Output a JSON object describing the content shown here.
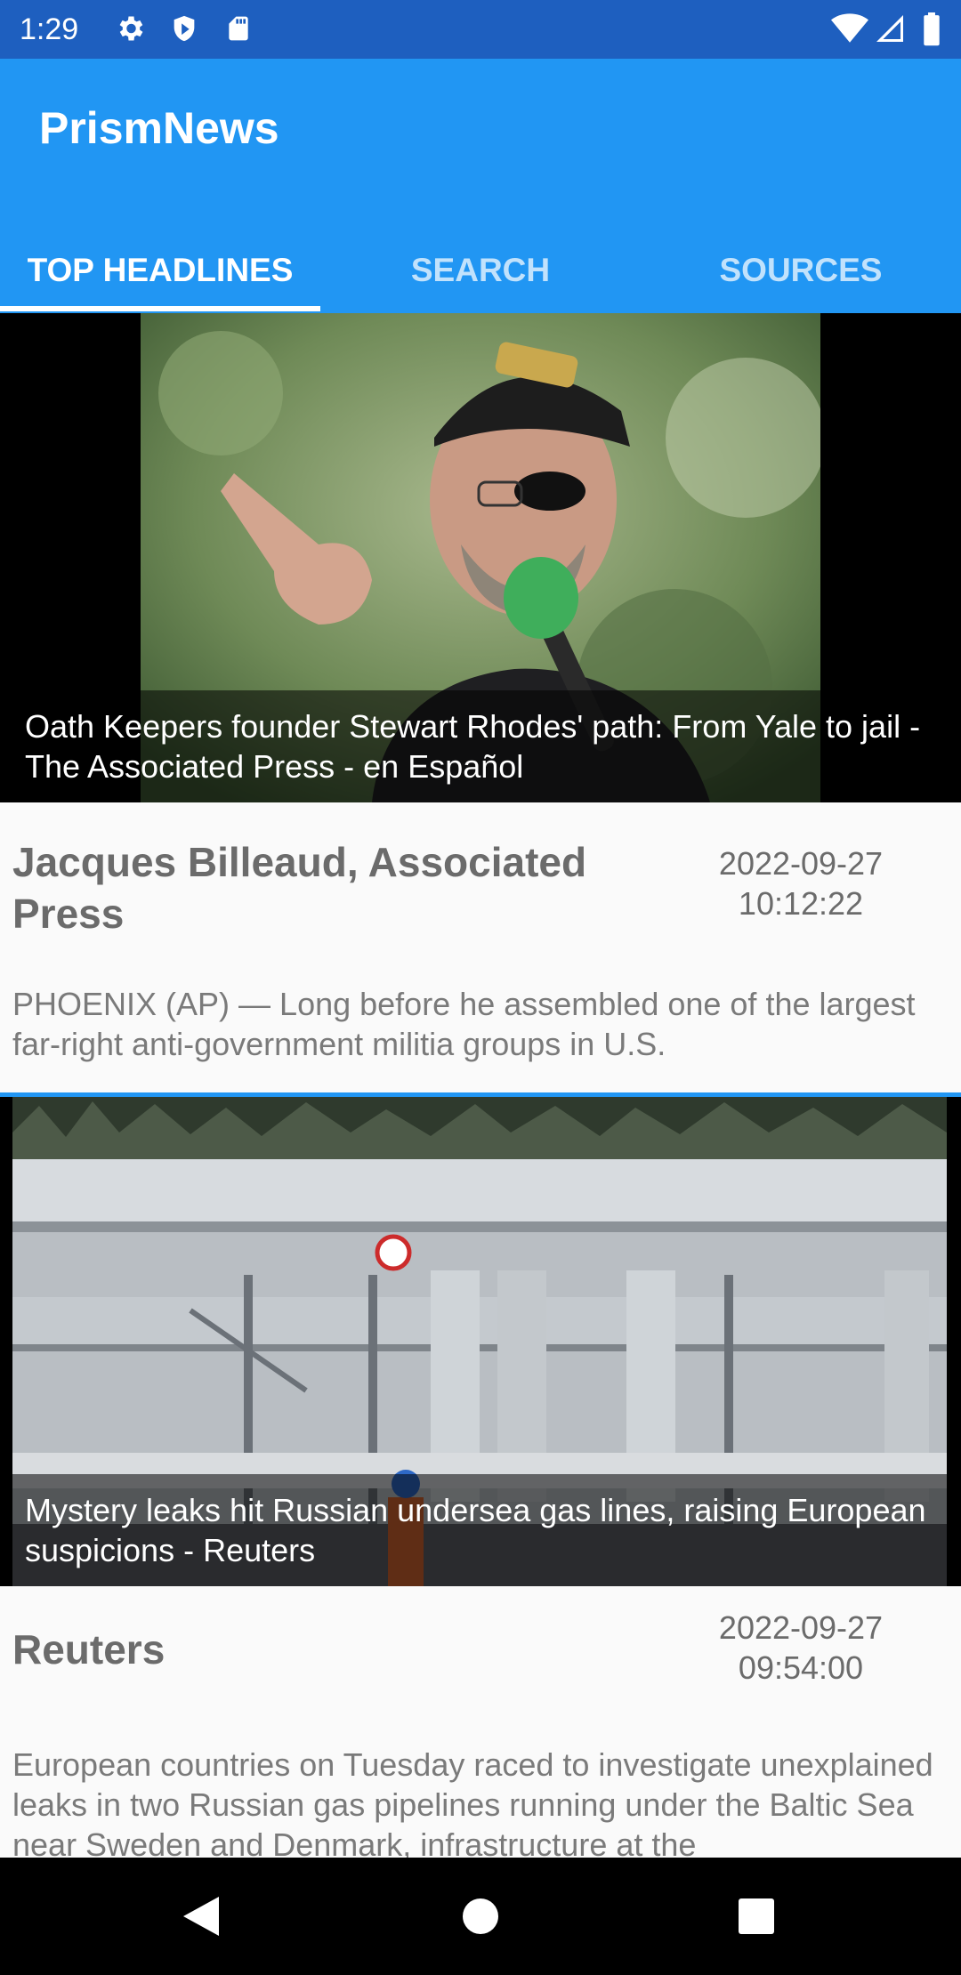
{
  "status_bar": {
    "time": "1:29",
    "icons": [
      "gear-icon",
      "shield-icon",
      "sd-card-icon",
      "wifi-icon",
      "signal-icon",
      "battery-icon"
    ]
  },
  "app": {
    "title": "PrismNews",
    "accent_color": "#2196f3"
  },
  "tabs": [
    {
      "label": "TOP HEADLINES",
      "active": true
    },
    {
      "label": "SEARCH",
      "active": false
    },
    {
      "label": "SOURCES",
      "active": false
    }
  ],
  "articles": [
    {
      "headline": "Oath Keepers founder Stewart Rhodes' path: From Yale to jail - The Associated Press - en Español",
      "author": "Jacques Billeaud, Associated Press",
      "date": "2022-09-27",
      "time": "10:12:22",
      "description": "PHOENIX (AP) — Long before he assembled one of the largest far-right anti-government militia groups  in U.S."
    },
    {
      "headline": "Mystery leaks hit Russian undersea gas lines, raising European suspicions - Reuters",
      "author": "Reuters",
      "date": "2022-09-27",
      "time": "09:54:00",
      "description": "European countries on Tuesday raced to investigate unexplained leaks in two Russian gas pipelines running under the Baltic Sea near Sweden and Denmark, infrastructure at the"
    }
  ],
  "nav_bar": {
    "buttons": [
      "back-icon",
      "home-icon",
      "recents-icon"
    ]
  }
}
